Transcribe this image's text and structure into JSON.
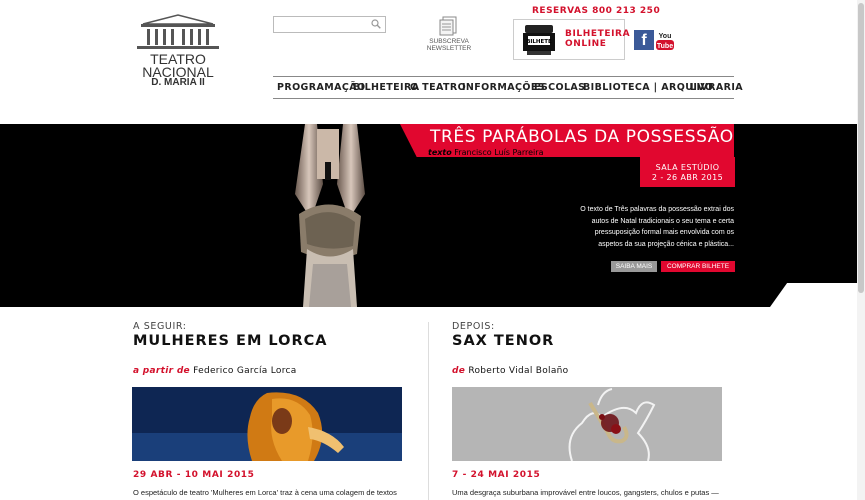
{
  "header": {
    "logo": {
      "line1": "TEATRO",
      "line2": "NACIONAL",
      "line3": "D. MARIA II"
    },
    "search": {
      "placeholder": ""
    },
    "newsletter": {
      "line1": "SUBSCREVA",
      "line2": "NEWSLETTER"
    },
    "phone": "RESERVAS 800 213 250",
    "ticket": {
      "line1": "BILHETEIRA",
      "line2": "ONLINE",
      "ticket_text": "BILHETE"
    },
    "social": {
      "facebook": "f",
      "youtube": "You Tube"
    }
  },
  "nav": {
    "items": [
      {
        "label": "PROGRAMAÇÃO"
      },
      {
        "label": "BILHETEIRA"
      },
      {
        "label": "O TEATRO"
      },
      {
        "label": "INFORMAÇÕES"
      },
      {
        "label": "ESCOLAS"
      },
      {
        "label": "BIBLIOTECA | ARQUIVO"
      },
      {
        "label": "LIVRARIA"
      }
    ]
  },
  "hero": {
    "title": "TRÊS PARÁBOLAS DA POSSESSÃO",
    "author_prefix": "texto",
    "author": "Francisco Luís Parreira",
    "venue": "SALA ESTÚDIO",
    "dates": "2 - 26 ABR 2015",
    "description": [
      "O texto de Três palavras da possessão extrai dos",
      "autos de Natal tradicionais o seu tema e certa",
      "pressuposição formal mais envolvida com os",
      "aspetos da sua projeção cénica e plástica..."
    ],
    "button_more": "SAIBA MAIS",
    "button_buy": "COMPRAR BILHETE"
  },
  "columns": [
    {
      "label": "A SEGUIR:",
      "title": "MULHERES EM LORCA",
      "author_prefix": "a partir de",
      "author": "Federico García Lorca",
      "dates": "29 ABR - 10 MAI 2015",
      "description": "O espetáculo de teatro 'Mulheres em Lorca' traz à cena uma colagem de textos"
    },
    {
      "label": "DEPOIS:",
      "title": "SAX TENOR",
      "author_prefix": "de",
      "author": "Roberto Vidal Bolaño",
      "dates": "7 - 24 MAI 2015",
      "description": "Uma desgraça suburbana improvável entre loucos, gangsters, chulos e putas —"
    }
  ],
  "colors": {
    "accent": "#e1072f",
    "text": "#111111",
    "hero_bg": "#000000"
  }
}
